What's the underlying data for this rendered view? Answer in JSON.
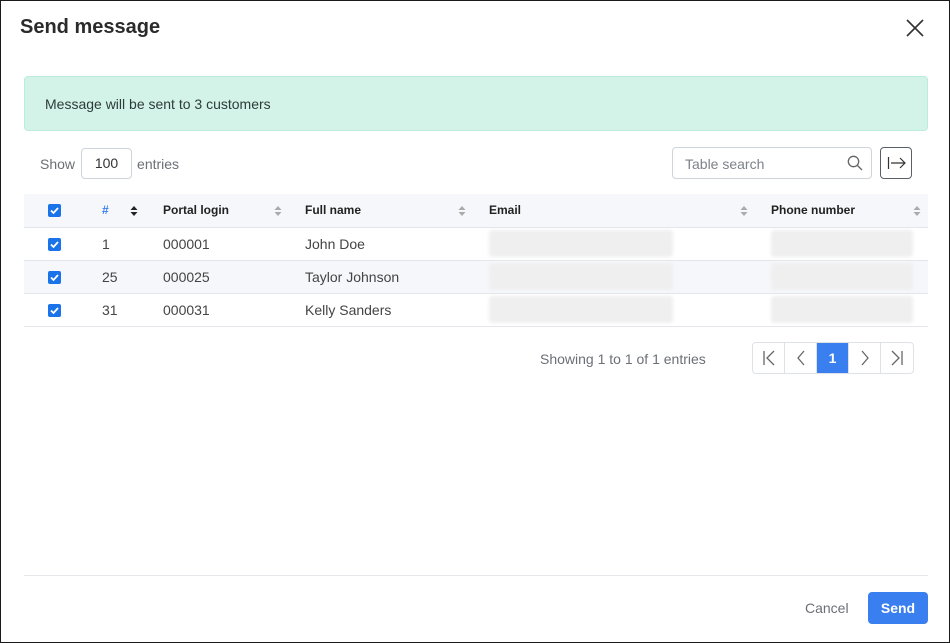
{
  "dialog": {
    "title": "Send message",
    "alert_text": "Message will be sent to 3 customers"
  },
  "controls": {
    "show_label": "Show",
    "entries_value": "100",
    "entries_label": "entries",
    "search_placeholder": "Table search"
  },
  "table": {
    "columns": [
      "#",
      "Portal login",
      "Full name",
      "Email",
      "Phone number"
    ],
    "rows": [
      {
        "checked": true,
        "id": "1",
        "login": "000001",
        "name": "John Doe",
        "email": "",
        "phone": ""
      },
      {
        "checked": true,
        "id": "25",
        "login": "000025",
        "name": "Taylor Johnson",
        "email": "",
        "phone": ""
      },
      {
        "checked": true,
        "id": "31",
        "login": "000031",
        "name": "Kelly Sanders",
        "email": "",
        "phone": ""
      }
    ]
  },
  "pagination": {
    "info": "Showing 1 to 1 of 1 entries",
    "current_page": "1"
  },
  "footer": {
    "cancel_label": "Cancel",
    "send_label": "Send"
  },
  "colors": {
    "accent": "#3a7ff0",
    "alert_bg": "#d4f3e8"
  }
}
